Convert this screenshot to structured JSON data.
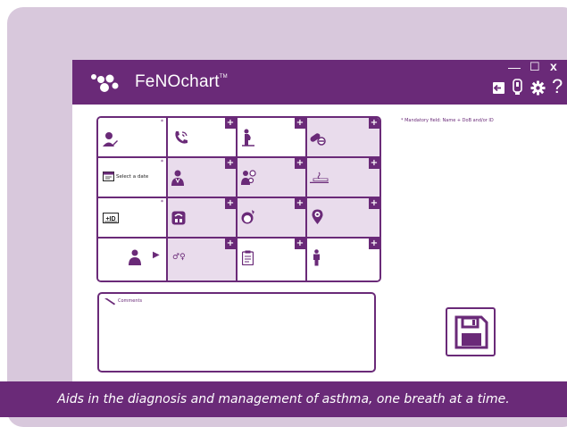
{
  "app": {
    "brand": "FeNOchart",
    "trademark": "TM",
    "brand_color": "#6a2a78",
    "shade_color": "#e9dcec",
    "window": {
      "minimize": "—",
      "maximize": "☐",
      "close": "x"
    }
  },
  "toolbar": {
    "icons": [
      "logout-icon",
      "device-icon",
      "settings-gear-icon",
      "help-question-icon"
    ],
    "help_label": "?"
  },
  "form": {
    "date_placeholder": "Select a date",
    "mandatory_note": "* Mandatory field: Name + DoB and/or ID",
    "required_marker": "*",
    "add_symbol": "+",
    "gender_symbol": "♂♀",
    "play_symbol": "▶"
  },
  "comments": {
    "label": "Comments"
  },
  "footer": {
    "tagline": "Aids in the diagnosis and management of asthma, one breath at a time."
  }
}
